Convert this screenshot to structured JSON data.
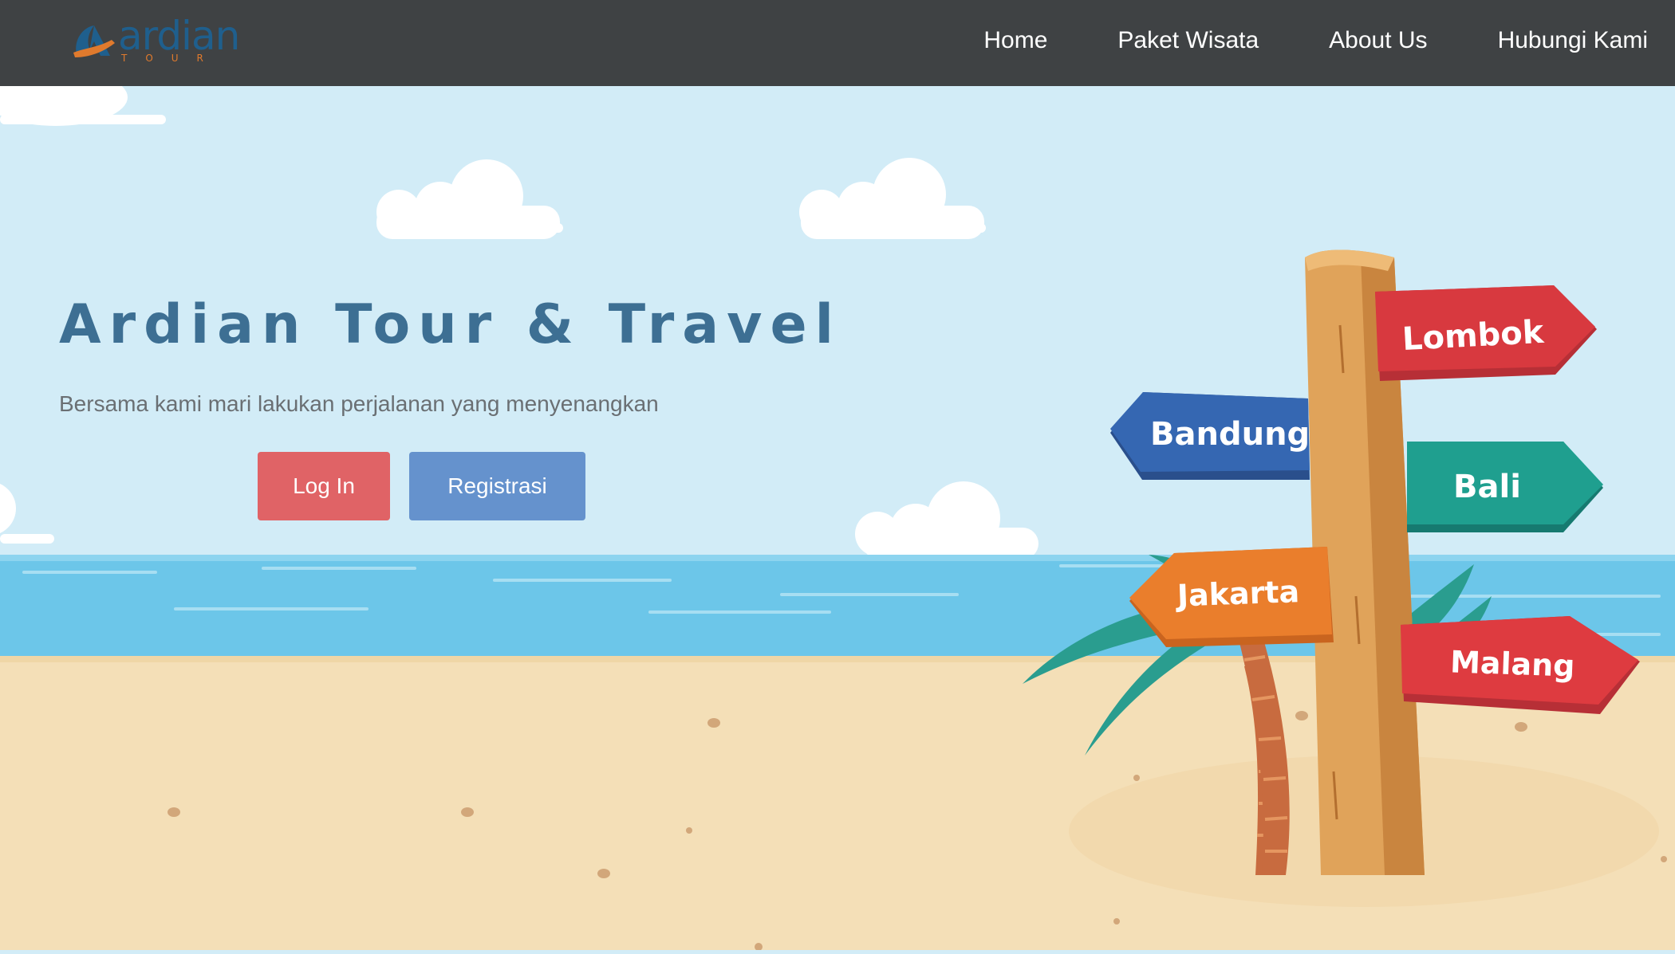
{
  "brand": {
    "name": "ardian",
    "tagline": "TOUR"
  },
  "nav": [
    {
      "label": "Home"
    },
    {
      "label": "Paket Wisata"
    },
    {
      "label": "About Us"
    },
    {
      "label": "Hubungi Kami"
    }
  ],
  "hero": {
    "title": "Ardian Tour & Travel",
    "subtitle": "Bersama kami mari lakukan perjalanan yang menyenangkan",
    "login_label": "Log In",
    "register_label": "Registrasi"
  },
  "signpost": {
    "signs": [
      {
        "label": "Lombok",
        "color": "#d8393f"
      },
      {
        "label": "Bandung",
        "color": "#3567b2"
      },
      {
        "label": "Bali",
        "color": "#1f9f8f"
      },
      {
        "label": "Jakarta",
        "color": "#ea7e2c"
      },
      {
        "label": "Malang",
        "color": "#de3b40"
      }
    ]
  },
  "colors": {
    "navbar": "#3f4244",
    "sky": "#d2ecf7",
    "sea": "#6cc6e9",
    "sand": "#f4dfb7",
    "title": "#3d6f93",
    "login": "#e06366",
    "register": "#6592cd"
  }
}
